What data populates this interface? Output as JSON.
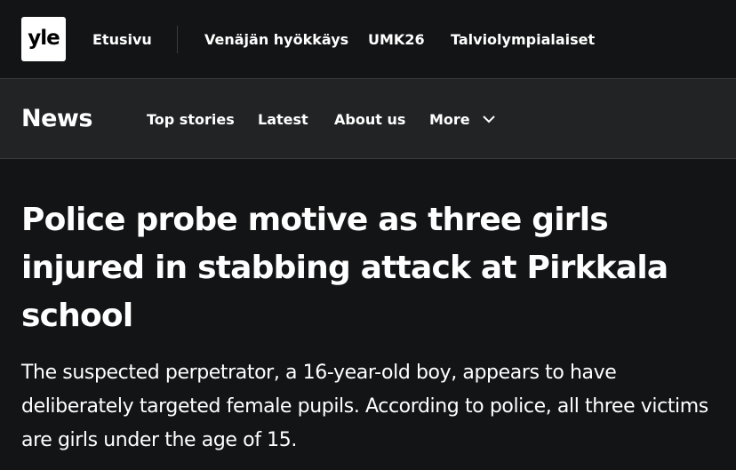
{
  "brand": {
    "logo_text": "yle"
  },
  "top_nav": {
    "home": "Etusivu",
    "items": [
      "Venäjän hyökkäys",
      "UMK26",
      "Talviolympialaiset"
    ]
  },
  "section_nav": {
    "title": "News",
    "items": [
      "Top stories",
      "Latest",
      "About us",
      "More"
    ],
    "more_icon": "chevron-down-icon"
  },
  "article": {
    "headline": "Police probe motive as three girls injured in stabbing attack at Pirkkala school",
    "lead": "The suspected perpetrator, a 16-year-old boy, appears to have deliberately targeted female pupils. According to police, all three victims are girls under the age of 15."
  },
  "colors": {
    "page_bg": "#131415",
    "subnav_bg": "#222325",
    "divider": "#3a3b3d",
    "text": "#ffffff",
    "logo_bg": "#ffffff",
    "logo_text": "#000000"
  }
}
